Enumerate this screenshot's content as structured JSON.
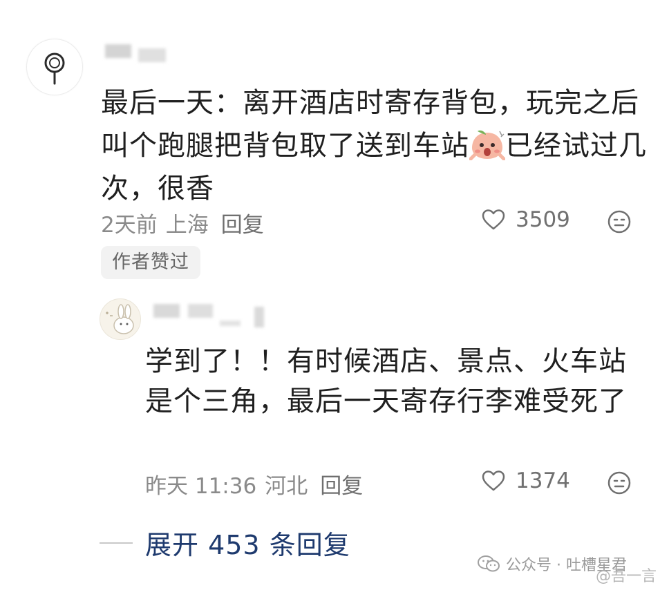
{
  "main_comment": {
    "avatar_icon": "lollipop-avatar-icon",
    "text_part1": "最后一天：离开酒店时寄存背包，玩完之后叫个跑腿把背包取了送到车站",
    "emoji": "peach-shocked-emoji",
    "text_part2": "已经试过几次，很香",
    "time": "2天前",
    "location": "上海",
    "reply_label": "回复",
    "likes": "3509",
    "badge": "作者赞过"
  },
  "reply_comment": {
    "text": "学到了！！有时候酒店、景点、火车站是个三角，最后一天寄存行李难受死了",
    "time": "昨天 11:36",
    "location": "河北",
    "reply_label": "回复",
    "likes": "1374"
  },
  "expand": {
    "label": "展开 453 条回复"
  },
  "watermark": {
    "account": "公众号 · 吐槽星君",
    "weibo": "@吾一言"
  },
  "colors": {
    "meta_gray": "#8a8a8a",
    "link_blue": "#1e3a6e",
    "badge_bg": "#f2f2f2"
  }
}
